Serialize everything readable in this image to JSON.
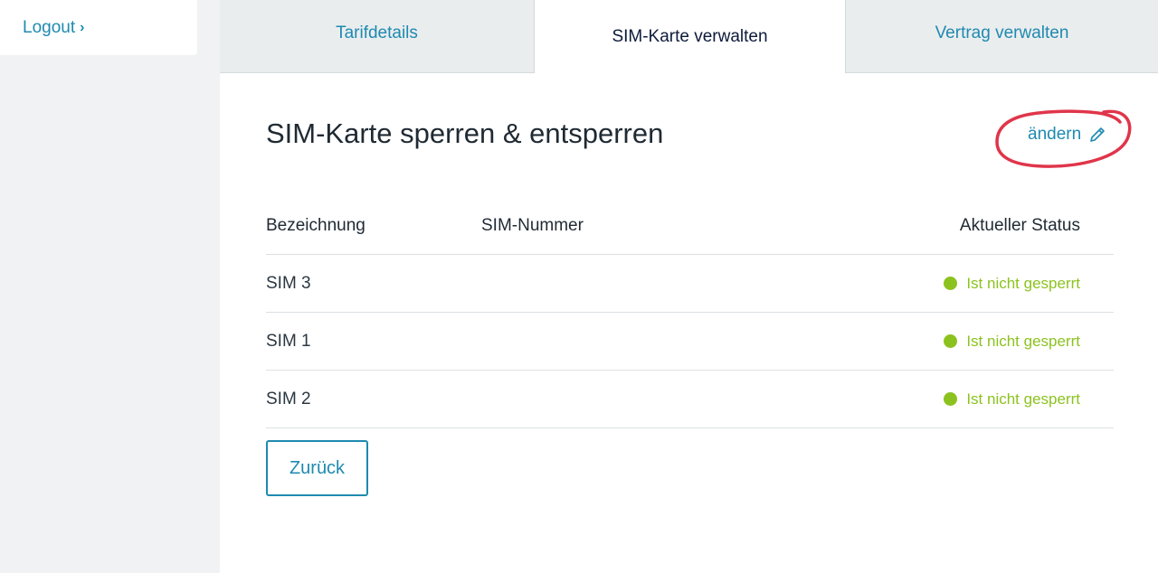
{
  "sidebar": {
    "logout_label": "Logout",
    "logout_chevron": "›"
  },
  "tabs": [
    {
      "label": "Tarifdetails",
      "active": false
    },
    {
      "label": "SIM-Karte verwalten",
      "active": true
    },
    {
      "label": "Vertrag verwalten",
      "active": false
    }
  ],
  "section": {
    "title": "SIM-Karte sperren & entsperren",
    "edit_label": "ändern",
    "edit_icon": "pencil-icon",
    "annotation_color": "#e0354a"
  },
  "table": {
    "headers": {
      "name": "Bezeichnung",
      "number": "SIM-Nummer",
      "status": "Aktueller Status"
    },
    "rows": [
      {
        "name": "SIM 3",
        "number": "",
        "status": "Ist nicht gesperrt"
      },
      {
        "name": "SIM 1",
        "number": "",
        "status": "Ist nicht gesperrt"
      },
      {
        "name": "SIM 2",
        "number": "",
        "status": "Ist nicht gesperrt"
      }
    ]
  },
  "actions": {
    "back_label": "Zurück"
  },
  "colors": {
    "accent": "#1e8ab0",
    "status_ok": "#8cc21f",
    "tab_inactive_bg": "#eaedee",
    "page_bg": "#f0f2f3"
  }
}
